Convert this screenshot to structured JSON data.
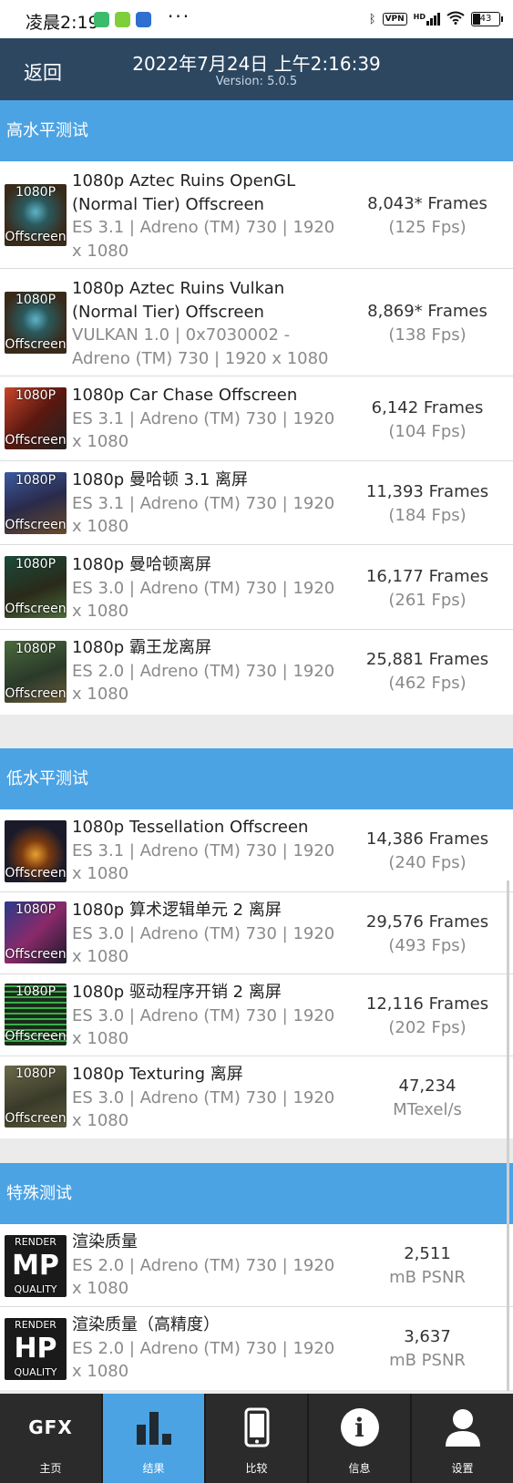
{
  "status_bar": {
    "time": "凌晨2:19",
    "dots": "···",
    "vpn": "VPN",
    "hd": "HD",
    "battery": "43"
  },
  "header": {
    "back": "返回",
    "title": "2022年7月24日 上午2:16:39",
    "version": "Version: 5.0.5"
  },
  "sections": {
    "high": "高水平测试",
    "low": "低水平测试",
    "special": "特殊测试"
  },
  "thumb": {
    "res": "1080P",
    "off": "Offscreen"
  },
  "rows": [
    {
      "name": "1080p Aztec Ruins OpenGL (Normal Tier) Offscreen",
      "desc": "ES 3.1 | Adreno (TM) 730 | 1920 x 1080",
      "value": "8,043* Frames",
      "unit": "(125 Fps)"
    },
    {
      "name": "1080p Aztec Ruins Vulkan (Normal Tier) Offscreen",
      "desc": "VULKAN 1.0 | 0x7030002 - Adreno (TM) 730 | 1920 x 1080",
      "value": "8,869* Frames",
      "unit": "(138 Fps)"
    },
    {
      "name": "1080p Car Chase Offscreen",
      "desc": "ES 3.1 | Adreno (TM) 730 | 1920 x 1080",
      "value": "6,142 Frames",
      "unit": "(104 Fps)"
    },
    {
      "name": "1080p 曼哈顿 3.1 离屏",
      "desc": "ES 3.1 | Adreno (TM) 730 | 1920 x 1080",
      "value": "11,393 Frames",
      "unit": "(184 Fps)"
    },
    {
      "name": "1080p 曼哈顿离屏",
      "desc": "ES 3.0 | Adreno (TM) 730 | 1920 x 1080",
      "value": "16,177 Frames",
      "unit": "(261 Fps)"
    },
    {
      "name": "1080p 霸王龙离屏",
      "desc": "ES 2.0 | Adreno (TM) 730 | 1920 x 1080",
      "value": "25,881 Frames",
      "unit": "(462 Fps)"
    },
    {
      "name": "1080p Tessellation Offscreen",
      "desc": "ES 3.1 | Adreno (TM) 730 | 1920 x 1080",
      "value": "14,386 Frames",
      "unit": "(240 Fps)"
    },
    {
      "name": "1080p 算术逻辑单元 2 离屏",
      "desc": "ES 3.0 | Adreno (TM) 730 | 1920 x 1080",
      "value": "29,576 Frames",
      "unit": "(493 Fps)"
    },
    {
      "name": "1080p 驱动程序开销 2 离屏",
      "desc": "ES 3.0 | Adreno (TM) 730 | 1920 x 1080",
      "value": "12,116 Frames",
      "unit": "(202 Fps)"
    },
    {
      "name": "1080p Texturing 离屏",
      "desc": "ES 3.0 | Adreno (TM) 730 | 1920 x 1080",
      "value": "47,234",
      "unit": "MTexel/s"
    },
    {
      "name": "渲染质量",
      "desc": "ES 2.0 | Adreno (TM) 730 | 1920 x 1080",
      "value": "2,511",
      "unit": "mB PSNR",
      "badge_top": "RENDER",
      "badge_big": "MP",
      "badge_bottom": "QUALITY"
    },
    {
      "name": "渲染质量（高精度）",
      "desc": "ES 2.0 | Adreno (TM) 730 | 1920 x 1080",
      "value": "3,637",
      "unit": "mB PSNR",
      "badge_top": "RENDER",
      "badge_big": "HP",
      "badge_bottom": "QUALITY"
    }
  ],
  "nav": [
    {
      "label": "主页",
      "icon": "gfx-logo-icon",
      "glyph": "GFX"
    },
    {
      "label": "结果",
      "icon": "bar-chart-icon"
    },
    {
      "label": "比较",
      "icon": "phone-icon"
    },
    {
      "label": "信息",
      "icon": "info-icon",
      "glyph": "i"
    },
    {
      "label": "设置",
      "icon": "user-icon"
    }
  ]
}
